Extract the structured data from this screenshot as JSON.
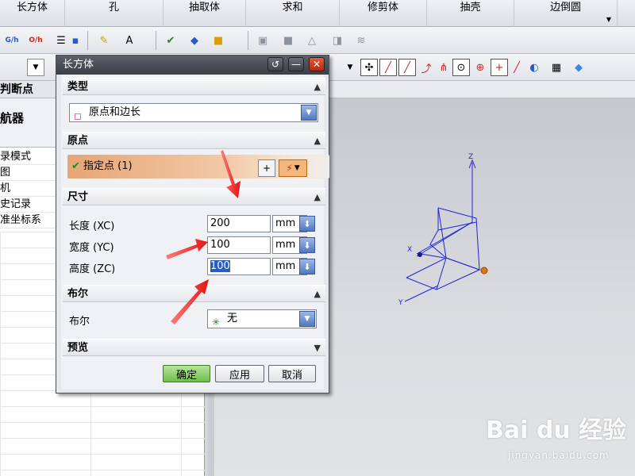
{
  "ribbon": {
    "items": [
      "长方体",
      "孔",
      "抽取体",
      "求和",
      "修剪体",
      "抽壳",
      "边倒圆"
    ]
  },
  "navigator": {
    "header_partial": "判断点",
    "title_partial": "航器",
    "items": [
      "录模式",
      "图",
      "机",
      "史记录",
      "准坐标系"
    ]
  },
  "dialog": {
    "title": "长方体",
    "sections": {
      "type": "类型",
      "origin": "原点",
      "dimensions": "尺寸",
      "boolean": "布尔",
      "preview": "预览"
    },
    "type_value": "原点和边长",
    "origin_label": "指定点 (1)",
    "dims": [
      {
        "label": "长度 (XC)",
        "value": "200",
        "unit": "mm"
      },
      {
        "label": "宽度 (YC)",
        "value": "100",
        "unit": "mm"
      },
      {
        "label": "高度 (ZC)",
        "value": "100",
        "unit": "mm"
      }
    ],
    "boolean_label": "布尔",
    "boolean_value": "无",
    "buttons": {
      "ok": "确定",
      "apply": "应用",
      "cancel": "取消"
    }
  },
  "axes": {
    "z": "Z",
    "x": "X",
    "y": "Y"
  },
  "watermark": {
    "brand": "Bai du 经验",
    "url": "jingyan.baidu.com"
  },
  "colors": {
    "accent_blue": "#2a5bc2",
    "origin_highlight": "#e6a574",
    "ok_green": "#6fbf4b",
    "close_red": "#c9361a",
    "wireframe_blue": "#2222dd",
    "arrow_red": "#e21313"
  }
}
